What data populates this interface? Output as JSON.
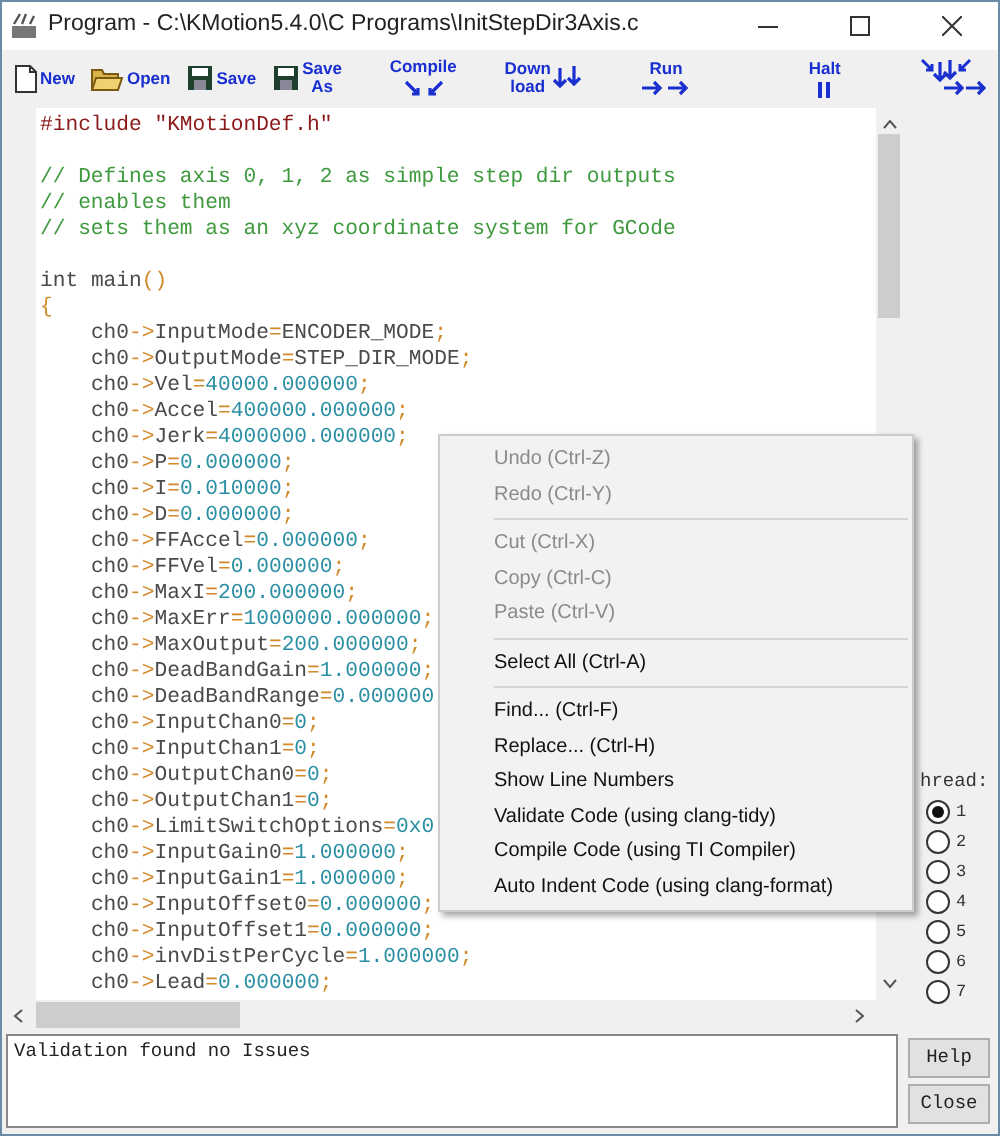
{
  "window": {
    "title": "Program - C:\\KMotion5.4.0\\C Programs\\InitStepDir3Axis.c"
  },
  "toolbar": [
    {
      "kind": "new",
      "label": "New"
    },
    {
      "kind": "open",
      "label": "Open"
    },
    {
      "kind": "save",
      "label": "Save"
    },
    {
      "kind": "saveas",
      "label": "Save\nAs"
    },
    {
      "kind": "compile",
      "label": "Compile"
    },
    {
      "kind": "download",
      "label": "Down\nload"
    },
    {
      "kind": "run",
      "label": "Run"
    },
    {
      "kind": "halt",
      "label": "Halt"
    },
    {
      "kind": "arrows"
    }
  ],
  "editor": {
    "lines": [
      {
        "kind": "preprocessor",
        "text": "#include \"KMotionDef.h\""
      },
      {
        "kind": "blank"
      },
      {
        "kind": "comment",
        "text": "// Defines axis 0, 1, 2 as simple step dir outputs"
      },
      {
        "kind": "comment",
        "text": "// enables them"
      },
      {
        "kind": "comment",
        "text": "// sets them as an xyz coordinate system for GCode"
      },
      {
        "kind": "blank"
      },
      {
        "kind": "code",
        "text": "int main()"
      },
      {
        "kind": "code",
        "text": "{"
      },
      {
        "kind": "code",
        "text": "    ch0->InputMode=ENCODER_MODE;"
      },
      {
        "kind": "code",
        "text": "    ch0->OutputMode=STEP_DIR_MODE;"
      },
      {
        "kind": "code",
        "text": "    ch0->Vel=40000.000000;"
      },
      {
        "kind": "code",
        "text": "    ch0->Accel=400000.000000;"
      },
      {
        "kind": "code",
        "text": "    ch0->Jerk=4000000.000000;"
      },
      {
        "kind": "code",
        "text": "    ch0->P=0.000000;"
      },
      {
        "kind": "code",
        "text": "    ch0->I=0.010000;"
      },
      {
        "kind": "code",
        "text": "    ch0->D=0.000000;"
      },
      {
        "kind": "code",
        "text": "    ch0->FFAccel=0.000000;"
      },
      {
        "kind": "code",
        "text": "    ch0->FFVel=0.000000;"
      },
      {
        "kind": "code",
        "text": "    ch0->MaxI=200.000000;"
      },
      {
        "kind": "code",
        "text": "    ch0->MaxErr=1000000.000000;"
      },
      {
        "kind": "code",
        "text": "    ch0->MaxOutput=200.000000;"
      },
      {
        "kind": "code",
        "text": "    ch0->DeadBandGain=1.000000;"
      },
      {
        "kind": "code",
        "text": "    ch0->DeadBandRange=0.000000"
      },
      {
        "kind": "code",
        "text": "    ch0->InputChan0=0;"
      },
      {
        "kind": "code",
        "text": "    ch0->InputChan1=0;"
      },
      {
        "kind": "code",
        "text": "    ch0->OutputChan0=0;"
      },
      {
        "kind": "code",
        "text": "    ch0->OutputChan1=0;"
      },
      {
        "kind": "code",
        "text": "    ch0->LimitSwitchOptions=0x0"
      },
      {
        "kind": "code",
        "text": "    ch0->InputGain0=1.000000;"
      },
      {
        "kind": "code",
        "text": "    ch0->InputGain1=1.000000;"
      },
      {
        "kind": "code",
        "text": "    ch0->InputOffset0=0.000000;"
      },
      {
        "kind": "code",
        "text": "    ch0->InputOffset1=0.000000;"
      },
      {
        "kind": "code",
        "text": "    ch0->invDistPerCycle=1.000000;"
      },
      {
        "kind": "code",
        "text": "    ch0->Lead=0.000000;"
      }
    ]
  },
  "context_menu": [
    {
      "kind": "item",
      "label": "Undo (Ctrl-Z)",
      "disabled": true
    },
    {
      "kind": "item",
      "label": "Redo (Ctrl-Y)",
      "disabled": true
    },
    {
      "kind": "separator"
    },
    {
      "kind": "item",
      "label": "Cut (Ctrl-X)",
      "disabled": true
    },
    {
      "kind": "item",
      "label": "Copy (Ctrl-C)",
      "disabled": true
    },
    {
      "kind": "item",
      "label": "Paste (Ctrl-V)",
      "disabled": true
    },
    {
      "kind": "separator"
    },
    {
      "kind": "item",
      "label": "Select All (Ctrl-A)",
      "disabled": false
    },
    {
      "kind": "separator"
    },
    {
      "kind": "item",
      "label": "Find... (Ctrl-F)",
      "disabled": false
    },
    {
      "kind": "item",
      "label": "Replace... (Ctrl-H)",
      "disabled": false
    },
    {
      "kind": "item",
      "label": "Show Line Numbers",
      "disabled": false
    },
    {
      "kind": "item",
      "label": "Validate Code (using clang-tidy)",
      "disabled": false
    },
    {
      "kind": "item",
      "label": "Compile Code (using TI Compiler)",
      "disabled": false
    },
    {
      "kind": "item",
      "label": "Auto Indent Code (using clang-format)",
      "disabled": false
    }
  ],
  "thread": {
    "label": "hread:",
    "options": [
      {
        "label": "1",
        "selected": true
      },
      {
        "label": "2",
        "selected": false
      },
      {
        "label": "3",
        "selected": false
      },
      {
        "label": "4",
        "selected": false
      },
      {
        "label": "5",
        "selected": false
      },
      {
        "label": "6",
        "selected": false
      },
      {
        "label": "7",
        "selected": false
      }
    ]
  },
  "output": {
    "text": "Validation found no Issues"
  },
  "buttons": [
    {
      "label": "Help"
    },
    {
      "label": "Close"
    }
  ]
}
